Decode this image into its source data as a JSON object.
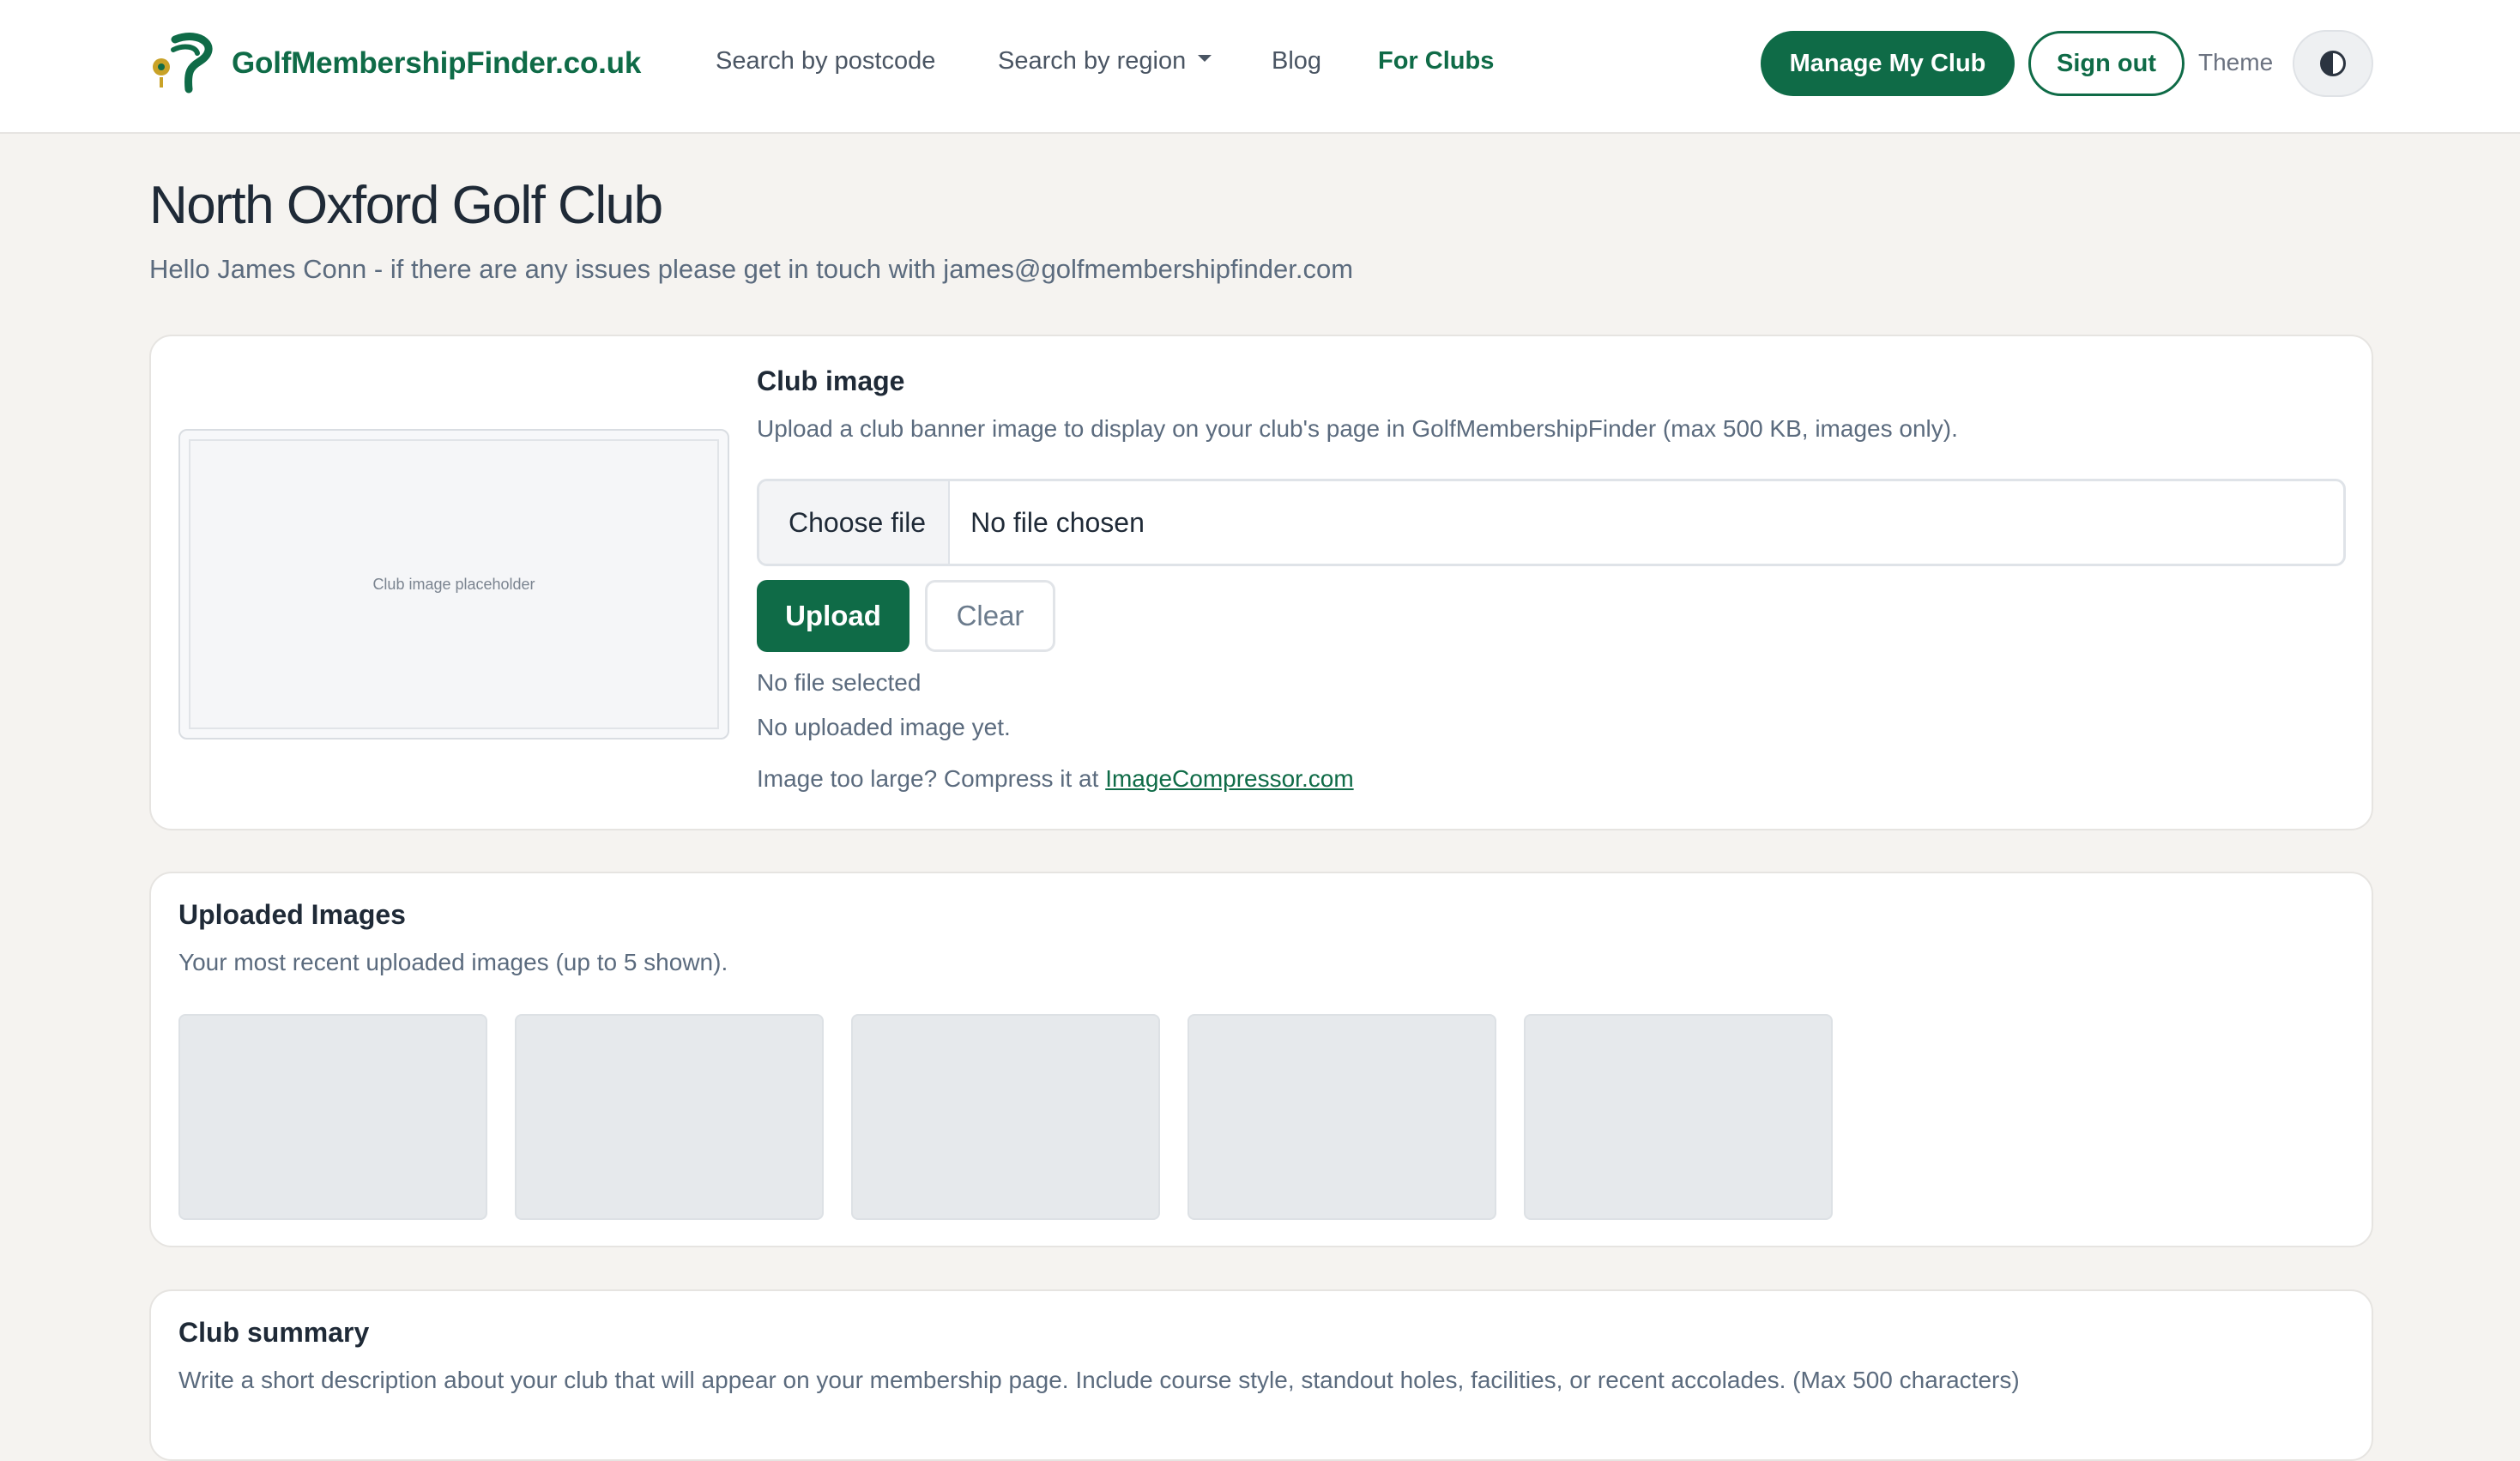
{
  "header": {
    "brand": "GolfMembershipFinder.co.uk",
    "nav": {
      "postcode": "Search by postcode",
      "region": "Search by region",
      "blog": "Blog",
      "clubs": "For Clubs"
    },
    "manage_label": "Manage My Club",
    "signout_label": "Sign out",
    "theme_label": "Theme"
  },
  "page": {
    "title": "North Oxford Golf Club",
    "subtitle": "Hello James Conn - if there are any issues please get in touch with james@golfmembershipfinder.com"
  },
  "club_image": {
    "placeholder": "Club image placeholder",
    "title": "Club image",
    "description": "Upload a club banner image to display on your club's page in GolfMembershipFinder (max 500 KB, images only).",
    "choose_label": "Choose file",
    "file_status": "No file chosen",
    "upload_label": "Upload",
    "clear_label": "Clear",
    "no_file_selected": "No file selected",
    "no_uploaded": "No uploaded image yet.",
    "compress_prefix": "Image too large? Compress it at ",
    "compress_link": "ImageCompressor.com"
  },
  "uploaded": {
    "title": "Uploaded Images",
    "description": "Your most recent uploaded images (up to 5 shown)."
  },
  "summary": {
    "title": "Club summary",
    "description": "Write a short description about your club that will appear on your membership page. Include course style, standout holes, facilities, or recent accolades. (Max 500 characters)"
  },
  "colors": {
    "brand_green": "#0f6b47",
    "background": "#f5f3f0",
    "muted_text": "#5b6b7e"
  }
}
